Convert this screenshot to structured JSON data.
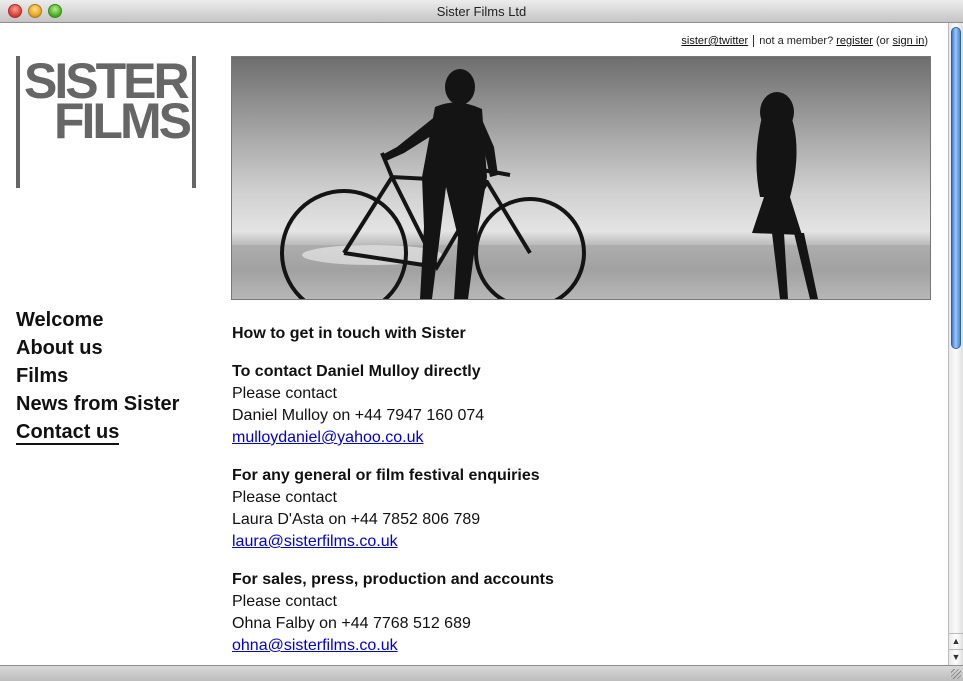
{
  "window": {
    "title": "Sister Films Ltd"
  },
  "logo": {
    "line1": "SISTER",
    "line2": "FILMS"
  },
  "toplinks": {
    "twitter": "sister@twitter",
    "not_member": "not a member?",
    "register": "register",
    "or_open": "(or",
    "signin": "sign in",
    "close": ")"
  },
  "nav": {
    "items": [
      {
        "label": "Welcome"
      },
      {
        "label": "About us"
      },
      {
        "label": "Films"
      },
      {
        "label": "News from Sister"
      },
      {
        "label": "Contact us",
        "active": true
      }
    ]
  },
  "main": {
    "heading": "How to get in touch with Sister",
    "blocks": [
      {
        "title": "To contact Daniel Mulloy directly",
        "line1": "Please contact",
        "line2": "Daniel Mulloy on +44 7947 160 074",
        "email": "mulloydaniel@yahoo.co.uk"
      },
      {
        "title": "For any general or film festival enquiries",
        "line1": "Please contact",
        "line2": "Laura D'Asta on +44 7852 806 789",
        "email": "laura@sisterfilms.co.uk"
      },
      {
        "title": "For sales, press, production and accounts",
        "line1": "Please contact",
        "line2": "Ohna Falby on +44 7768 512 689",
        "email": "ohna@sisterfilms.co.uk"
      }
    ]
  },
  "icons": {
    "scroll_up": "scroll-up-arrow-icon",
    "scroll_down": "scroll-down-arrow-icon"
  }
}
